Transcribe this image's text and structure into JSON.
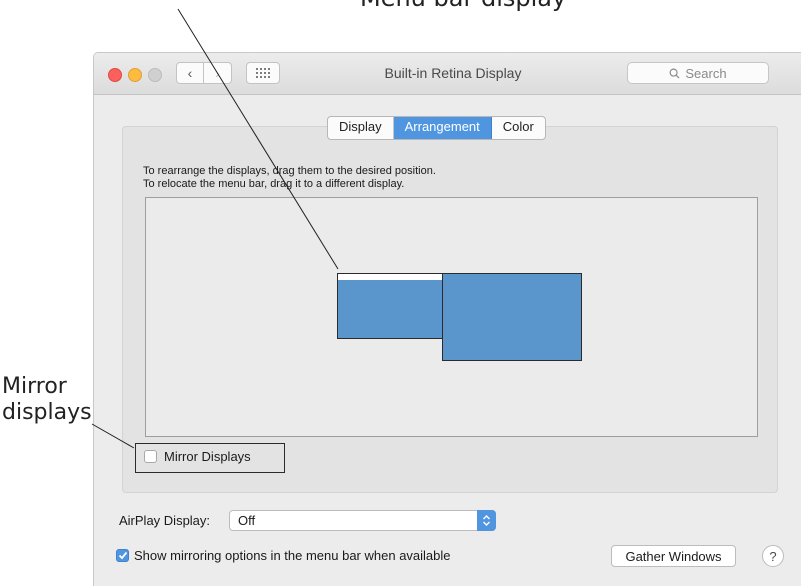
{
  "annotations": {
    "top_text": "Menu bar display",
    "left_text_line1": "Mirror",
    "left_text_line2": "displays"
  },
  "window": {
    "title": "Built-in Retina Display",
    "search_placeholder": "Search"
  },
  "tabs": [
    {
      "label": "Display",
      "active": false
    },
    {
      "label": "Arrangement",
      "active": true
    },
    {
      "label": "Color",
      "active": false
    }
  ],
  "instructions": {
    "line1": "To rearrange the displays, drag them to the desired position.",
    "line2": "To relocate the menu bar, drag it to a different display."
  },
  "mirror": {
    "label": "Mirror Displays",
    "checked": false
  },
  "airplay": {
    "label": "AirPlay Display:",
    "value": "Off"
  },
  "show_mirroring": {
    "label": "Show mirroring options in the menu bar when available",
    "checked": true
  },
  "buttons": {
    "gather": "Gather Windows",
    "help": "?"
  },
  "colors": {
    "accent": "#4f95e0",
    "display_fill": "#5a95cc",
    "traffic_red": "#fc605c",
    "traffic_yellow": "#fdbc40"
  }
}
